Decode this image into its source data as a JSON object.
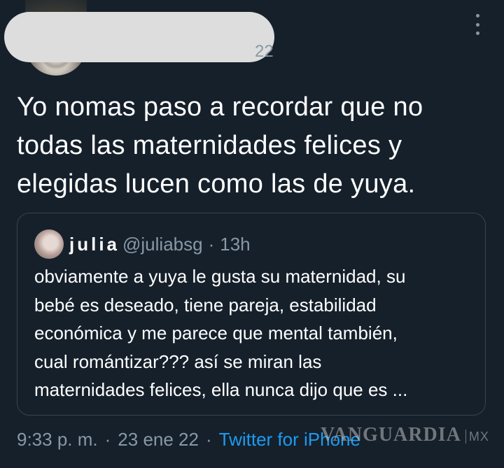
{
  "tweet": {
    "date_fragment": "22",
    "text": "Yo nomas paso a recordar que no\ntodas las maternidades felices y\nelegidas lucen como las de yuya."
  },
  "icons": {
    "more": "more-options-icon"
  },
  "quote": {
    "name": "julia",
    "handle": "@juliabsg",
    "separator": "·",
    "time": "13h",
    "text": "obviamente a yuya le gusta su maternidad, su\nbebé es deseado, tiene pareja, estabilidad\neconómica y me parece que mental también,\ncual romántizar??? así se miran las\nmaternidades felices, ella nunca dijo que es ..."
  },
  "footer": {
    "time": "9:33 p. m.",
    "separator": "·",
    "date": "23 ene 22",
    "source": "Twitter for iPhone"
  },
  "watermark": {
    "brand": "VANGUARDIA",
    "suffix": "MX"
  },
  "colors": {
    "background": "#15202b",
    "secondary_text": "#8899a6",
    "link": "#1d9bf0",
    "border": "#38444d"
  }
}
